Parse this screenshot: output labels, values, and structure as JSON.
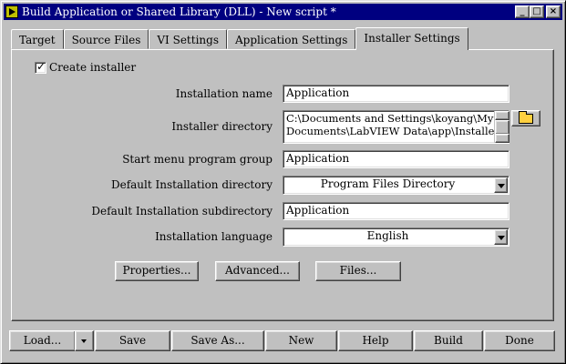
{
  "window": {
    "title": "Build Application or Shared Library (DLL) - New script *",
    "buttons": {
      "minimize": "_",
      "maximize": "□",
      "close": "×"
    }
  },
  "tabs": [
    {
      "label": "Target",
      "active": false
    },
    {
      "label": "Source Files",
      "active": false
    },
    {
      "label": "VI Settings",
      "active": false
    },
    {
      "label": "Application Settings",
      "active": false
    },
    {
      "label": "Installer Settings",
      "active": true
    }
  ],
  "installer": {
    "create_installer": {
      "label": "Create installer",
      "checked": true,
      "mark": "✓"
    },
    "installation_name": {
      "label": "Installation name",
      "value": "Application"
    },
    "installer_directory": {
      "label": "Installer directory",
      "line1": "C:\\Documents and Settings\\koyang\\My",
      "line2": "Documents\\LabVIEW Data\\app\\Installer"
    },
    "start_menu_group": {
      "label": "Start menu program group",
      "value": "Application"
    },
    "default_install_dir": {
      "label": "Default Installation directory",
      "value": "Program Files Directory"
    },
    "default_install_subdir": {
      "label": "Default Installation subdirectory",
      "value": "Application"
    },
    "install_language": {
      "label": "Installation language",
      "value": "English"
    },
    "buttons": {
      "properties": "Properties...",
      "advanced": "Advanced...",
      "files": "Files..."
    }
  },
  "footer": {
    "load": "Load...",
    "save": "Save",
    "save_as": "Save As...",
    "new": "New",
    "help": "Help",
    "build": "Build",
    "done": "Done"
  },
  "colors": {
    "face": "#c0c0c0",
    "titlebar": "#000080",
    "field": "#ffffff"
  }
}
